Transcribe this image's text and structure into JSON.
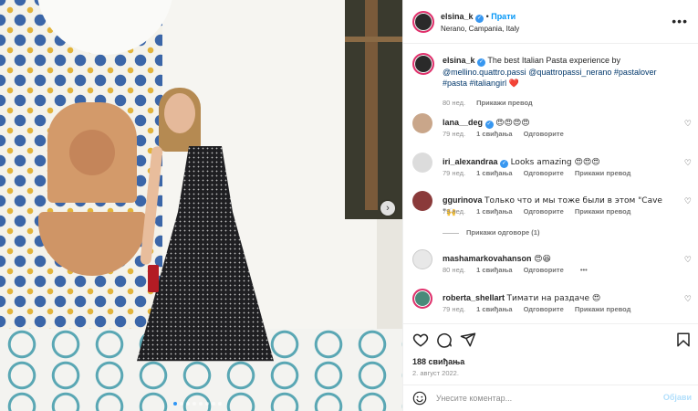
{
  "post": {
    "username": "elsina_k",
    "follow_label": "Прати",
    "location": "Nerano, Campania, Italy",
    "more_label": "•••"
  },
  "caption": {
    "username": "elsina_k",
    "text": "The best Italian Pasta experience by",
    "mention1": "@mellino.quattro.passi",
    "mention2": "@quattropassi_nerano",
    "tag1": "#pastalover",
    "tag2": "#pasta",
    "tag3": "#italiangirl",
    "emoji": "❤️",
    "time": "80 нед.",
    "translate": "Прикажи превод"
  },
  "comments": [
    {
      "username": "lana__deg",
      "verified": true,
      "text": "😍😍😍😍",
      "time": "79 нед.",
      "likes": "1 свиђања",
      "reply": "Одговорите",
      "translate": ""
    },
    {
      "username": "iri_alexandraa",
      "verified": true,
      "text": "Looks amazing 😍😍😍",
      "time": "79 нед.",
      "likes": "1 свиђања",
      "reply": "Одговорите",
      "translate": "Прикажи превод"
    },
    {
      "username": "ggurinova",
      "verified": false,
      "text": "Только что и мы тоже были в этом \"Cave \"🙌",
      "time": "79 нед.",
      "likes": "1 свиђања",
      "reply": "Одговорите",
      "translate": "Прикажи превод",
      "replies": "Прикажи одговоре (1)"
    },
    {
      "username": "mashamarkovahanson",
      "verified": false,
      "text": "😍😆",
      "time": "80 нед.",
      "likes": "1 свиђања",
      "reply": "Одговорите",
      "translate": "",
      "more": "•••"
    },
    {
      "username": "roberta_shellart",
      "verified": false,
      "text": "Тимати на раздаче 😍",
      "time": "79 нед.",
      "likes": "1 свиђања",
      "reply": "Одговорите",
      "translate": "Прикажи превод"
    }
  ],
  "footer": {
    "likes": "188 свиђања",
    "date": "2. август 2022.",
    "comment_placeholder": "Унесите коментар...",
    "post_label": "Објави"
  },
  "carousel": {
    "slide_count": 8,
    "active_index": 0
  },
  "colors": {
    "accent": "#0095f6",
    "verified": "#3897f0",
    "heart": "#ed4956"
  },
  "icons": [
    "heart-icon",
    "comment-icon",
    "share-icon",
    "bookmark-icon",
    "emoji-icon",
    "verified-icon",
    "chevron-right-icon"
  ]
}
